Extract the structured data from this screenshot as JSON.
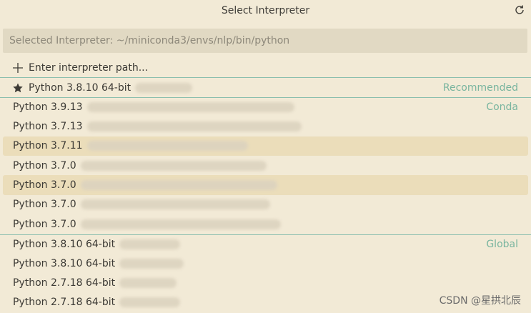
{
  "header": {
    "title": "Select Interpreter",
    "refresh_icon": "refresh-icon"
  },
  "input": {
    "value": "Selected Interpreter: ~/miniconda3/envs/nlp/bin/python"
  },
  "add_item": {
    "icon": "plus-icon",
    "label": "Enter interpreter path..."
  },
  "items": [
    {
      "label": "Python 3.8.10 64-bit",
      "tag": "Recommended",
      "icon": "star-icon"
    },
    {
      "label": "Python 3.9.13",
      "tag": "Conda"
    },
    {
      "label": "Python 3.7.13",
      "tag": ""
    },
    {
      "label": "Python 3.7.11",
      "tag": ""
    },
    {
      "label": "Python 3.7.0",
      "tag": ""
    },
    {
      "label": "Python 3.7.0",
      "tag": ""
    },
    {
      "label": "Python 3.7.0",
      "tag": ""
    },
    {
      "label": "Python 3.7.0",
      "tag": ""
    },
    {
      "label": "Python 3.8.10 64-bit",
      "tag": "Global"
    },
    {
      "label": "Python 3.8.10 64-bit",
      "tag": ""
    },
    {
      "label": "Python 2.7.18 64-bit",
      "tag": ""
    },
    {
      "label": "Python 2.7.18 64-bit",
      "tag": ""
    }
  ],
  "watermark": "CSDN @星拱北辰",
  "colors": {
    "background": "#f2ead6",
    "input_bg": "#e1d9c3",
    "highlight": "#ebddba",
    "separator": "#8bbfae",
    "tag_text": "#79b59f"
  }
}
